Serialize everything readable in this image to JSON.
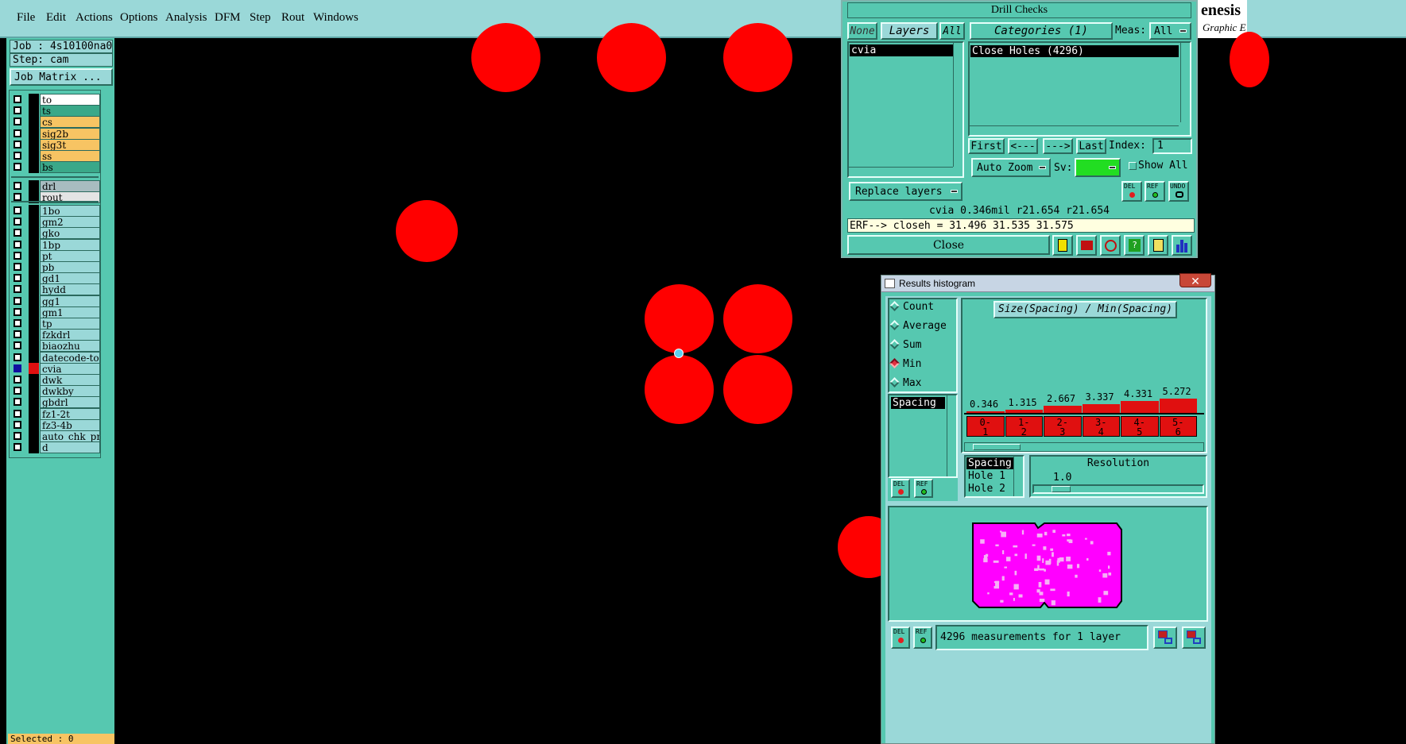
{
  "menubar": {
    "items": [
      "File",
      "Edit",
      "Actions",
      "Options",
      "Analysis",
      "DFM",
      "Step",
      "Rout",
      "Windows"
    ],
    "brand": "enesis",
    "brand_sub": "Graphic E"
  },
  "left": {
    "job": "Job : 4s10100na0",
    "step": "Step: cam",
    "job_matrix": "Job Matrix ...",
    "selected": "Selected : 0",
    "layers_group1": [
      {
        "name": "to",
        "color": "white"
      },
      {
        "name": "ts",
        "color": "green"
      },
      {
        "name": "cs",
        "color": "orange"
      },
      {
        "name": "sig2b",
        "color": "orange"
      },
      {
        "name": "sig3t",
        "color": "orange"
      },
      {
        "name": "ss",
        "color": "orange"
      },
      {
        "name": "bs",
        "color": "green"
      }
    ],
    "layers_group2": [
      {
        "name": "drl",
        "color": "grey"
      },
      {
        "name": "rout",
        "color": "lgrey"
      }
    ],
    "layers_group3": [
      "1bo",
      "gm2",
      "gko",
      "1bp",
      "pt",
      "pb",
      "gd1",
      "hydd",
      "gg1",
      "gm1",
      "tp",
      "fzkdrl",
      "biaozhu",
      "datecode-to",
      "cvia",
      "dwk",
      "dwkby",
      "gbdrl",
      "fz1-2t",
      "fz3-4b",
      "auto_chk_pn",
      "d"
    ]
  },
  "drill": {
    "title": "Drill Checks",
    "none_btn": "None",
    "layers_btn": "Layers",
    "all_btn": "All",
    "categories_btn": "Categories (1)",
    "meas_label": "Meas:",
    "meas_value": "All",
    "layer_item": "cvia",
    "category_item": "Close Holes (4296)",
    "first": "First",
    "prev": "<---",
    "next": "--->",
    "last": "Last",
    "index_label": "Index:",
    "index_value": "1",
    "auto_zoom": "Auto Zoom",
    "sv_label": "Sv:",
    "show_all": "Show All",
    "replace_layers": "Replace layers",
    "del": "DEL",
    "ref": "REF",
    "undo": "UNDO",
    "status": "cvia 0.346mil  r21.654  r21.654",
    "erf": "ERF--> closeh = 31.496 31.535 31.575",
    "close": "Close"
  },
  "hist": {
    "title": "Results histogram",
    "radios": [
      {
        "label": "Count",
        "selected": false
      },
      {
        "label": "Average",
        "selected": false
      },
      {
        "label": "Sum",
        "selected": false
      },
      {
        "label": "Min",
        "selected": true
      },
      {
        "label": "Max",
        "selected": false
      }
    ],
    "list_item": "Spacing",
    "chart_title": "Size(Spacing) / Min(Spacing)",
    "del": "DEL",
    "ref": "REF",
    "fields": [
      "Spacing",
      "Hole 1",
      "Hole 2"
    ],
    "resolution_label": "Resolution",
    "resolution_value": "1.0",
    "summary": "4296 measurements for 1 layer"
  },
  "chart_data": {
    "type": "bar",
    "title": "Size(Spacing) / Min(Spacing)",
    "categories": [
      "0-1",
      "1-2",
      "2-3",
      "3-4",
      "4-5",
      "5-6"
    ],
    "category_labels": [
      [
        "0-",
        "1"
      ],
      [
        "1-",
        "2"
      ],
      [
        "2-",
        "3"
      ],
      [
        "3-",
        "4"
      ],
      [
        "4-",
        "5"
      ],
      [
        "5-",
        "6"
      ]
    ],
    "values": [
      0.346,
      1.315,
      2.667,
      3.337,
      4.331,
      5.272
    ],
    "value_labels": [
      "0.346",
      "1.315",
      "2.667",
      "3.337",
      "4.331",
      "5.272"
    ],
    "ylim": [
      0,
      5.272
    ],
    "bar_color": "#e01010"
  },
  "colors": {
    "accent_teal": "#56c8b0",
    "light_teal": "#9ad8d8",
    "hole_red": "#ff0000",
    "board_magenta": "#ff00ff"
  }
}
